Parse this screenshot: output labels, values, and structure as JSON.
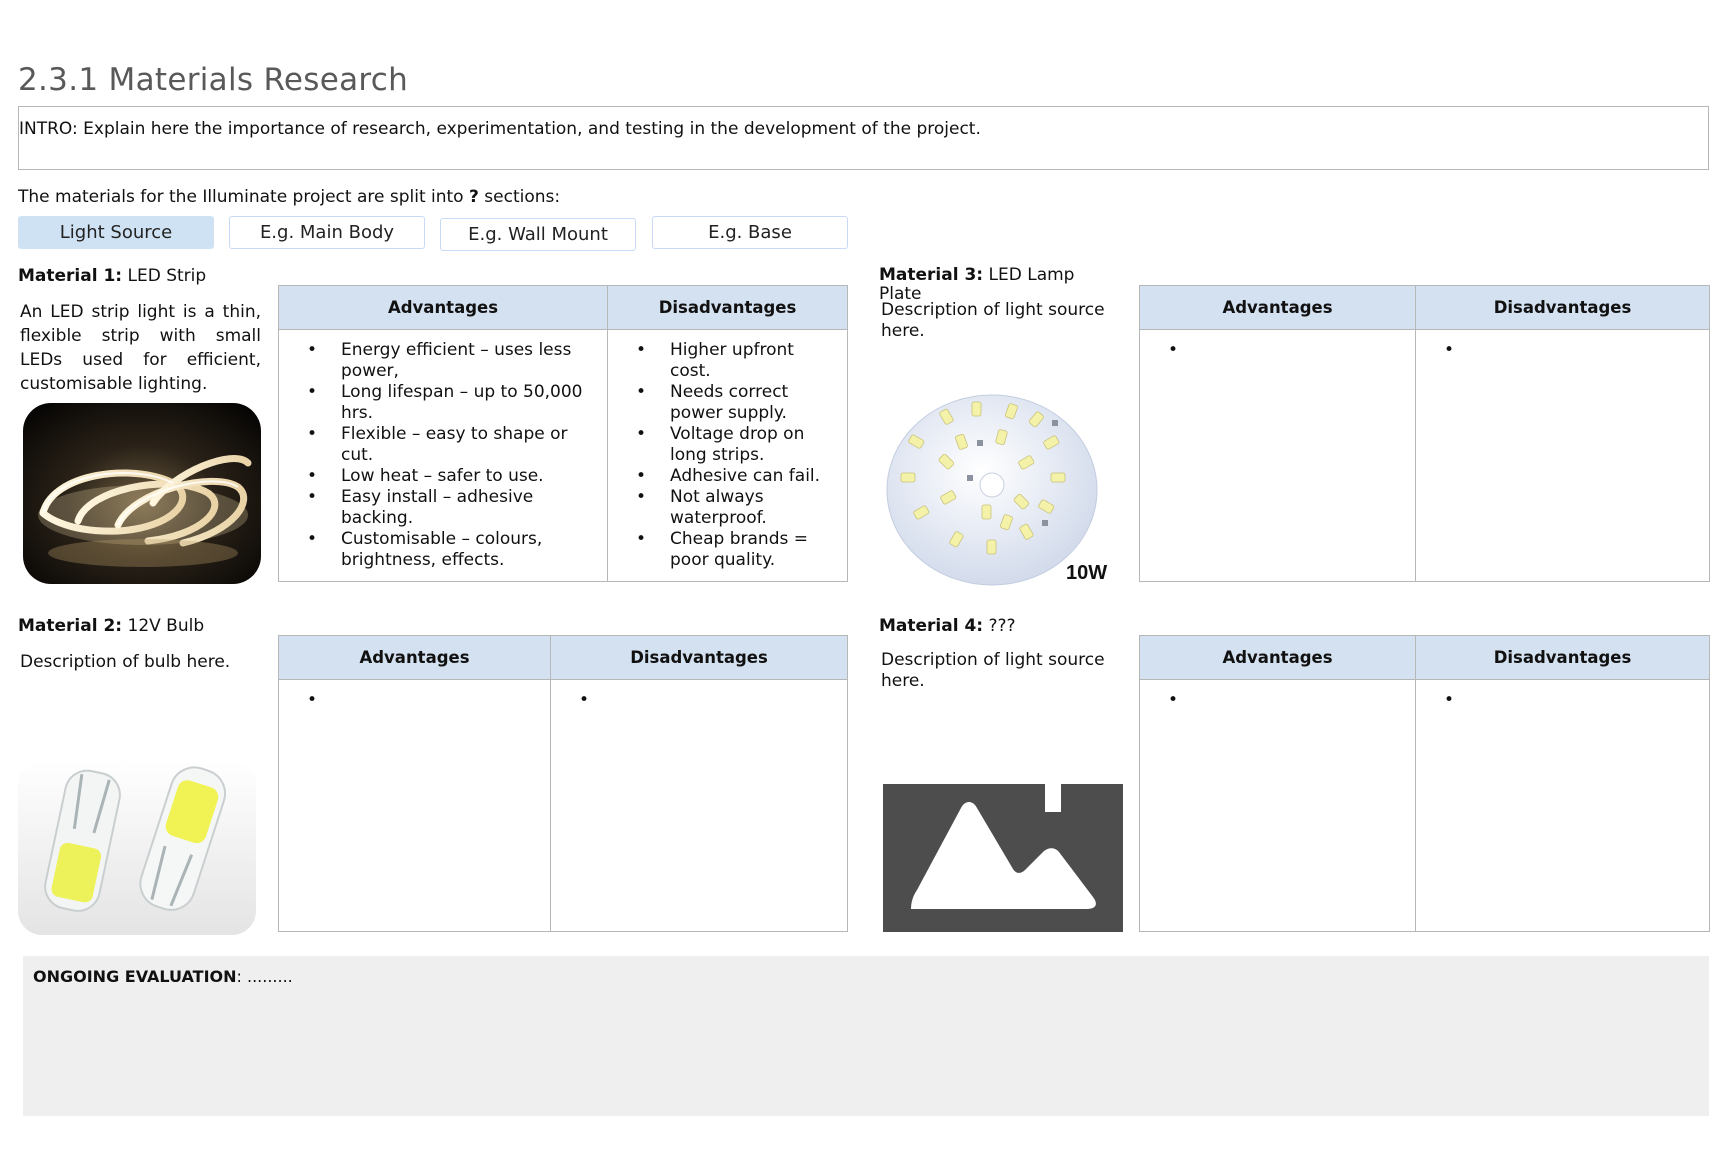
{
  "page": {
    "title": "2.3.1 Materials Research",
    "intro": "INTRO: Explain here the importance of research, experimentation, and testing in the development of the project.",
    "sections_prefix": "The materials for the Illuminate project are split into ",
    "sections_count": "?",
    "sections_suffix": " sections:"
  },
  "tabs": [
    {
      "label": "Light Source",
      "active": true
    },
    {
      "label": "E.g. Main Body",
      "active": false
    },
    {
      "label": "E.g. Wall Mount",
      "active": false
    },
    {
      "label": "E.g. Base",
      "active": false
    }
  ],
  "table_headers": {
    "advantages": "Advantages",
    "disadvantages": "Disadvantages"
  },
  "bullet": "•",
  "materials": [
    {
      "label": "Material 1:",
      "name": "LED Strip",
      "description": "An LED strip light is a thin, flexible strip with small LEDs used for efficient, customisable lighting.",
      "image_icon": "led-strip-photo",
      "advantages": [
        "Energy efficient – uses less power,",
        "Long lifespan – up to 50,000 hrs.",
        "Flexible – easy to shape or cut.",
        "Low heat – safer to use.",
        "Easy install – adhesive backing.",
        "Customisable – colours, brightness, effects."
      ],
      "disadvantages": [
        "Higher upfront cost.",
        "Needs correct power supply.",
        "Voltage drop on long strips.",
        "Adhesive can fail.",
        "Not always waterproof.",
        "Cheap brands = poor quality."
      ]
    },
    {
      "label": "Material 2:",
      "name": "12V Bulb",
      "description": "Description of bulb here.",
      "image_icon": "bulb-photo",
      "advantages": [
        ""
      ],
      "disadvantages": [
        ""
      ]
    },
    {
      "label": "Material 3:",
      "name": "LED Lamp Plate",
      "description": "Description of light source here.",
      "image_icon": "led-plate-photo",
      "image_text": "10W",
      "advantages": [
        ""
      ],
      "disadvantages": [
        ""
      ]
    },
    {
      "label": "Material 4:",
      "name": "???",
      "description": "Description of light source here.",
      "image_icon": "image-placeholder-icon",
      "advantages": [
        ""
      ],
      "disadvantages": [
        ""
      ]
    }
  ],
  "evaluation": {
    "label": "ONGOING EVALUATION",
    "text": ": ........."
  },
  "colors": {
    "header_bg": "#d4e1f0",
    "tab_active": "#cfe2f3",
    "eval_bg": "#efefef",
    "placeholder": "#4d4d4d"
  }
}
